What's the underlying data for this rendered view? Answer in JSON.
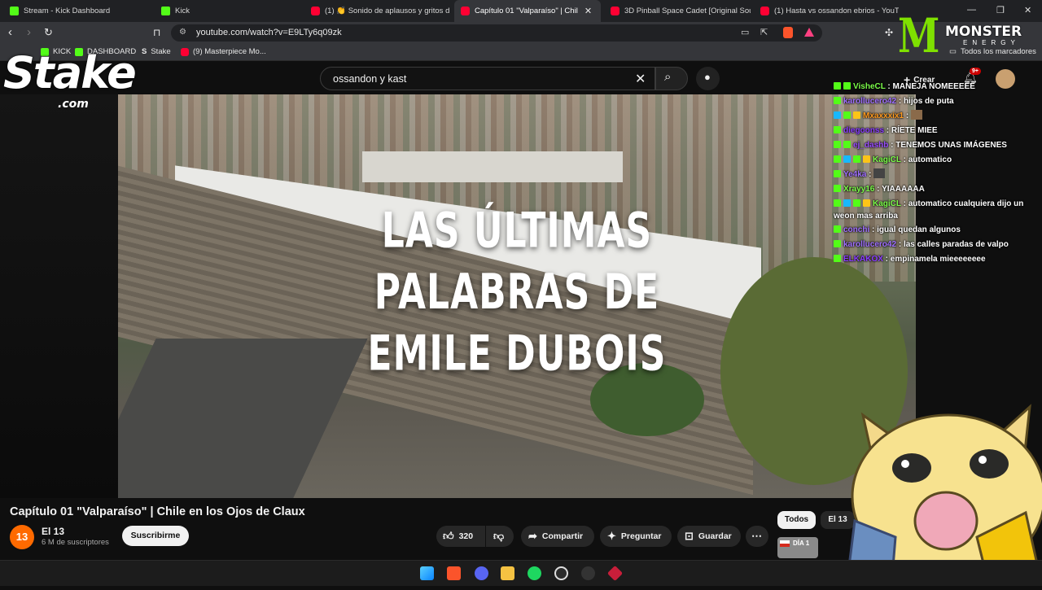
{
  "browser": {
    "tabs": [
      {
        "label": "Stream - Kick Dashboard",
        "icon": "kick-icon"
      },
      {
        "label": "Kick",
        "icon": "kick-icon"
      },
      {
        "label": "(1) 👏 Sonido de aplausos y gritos d",
        "icon": "youtube-icon"
      },
      {
        "label": "Capítulo 01 \"Valparaíso\" | Chil",
        "icon": "youtube-icon",
        "active": true
      },
      {
        "label": "3D Pinball Space Cadet [Original Sou",
        "icon": "youtube-icon"
      },
      {
        "label": "(1) Hasta vs ossandon ebrios - YouTu",
        "icon": "youtube-icon"
      }
    ],
    "url": "youtube.com/watch?v=E9LTy6q09zk",
    "bookmarks": [
      {
        "label": "KICK",
        "icon": "kick-icon"
      },
      {
        "label": "DASHBOARD",
        "icon": "kick-icon"
      },
      {
        "label": "Stake",
        "icon": "stake-icon"
      },
      {
        "label": "(9) Masterpiece Mo...",
        "icon": "youtube-icon"
      }
    ],
    "all_bookmarks": "Todos los marcadores"
  },
  "youtube": {
    "search_query": "ossandon y kast",
    "create_label": "Crear",
    "notifications_badge": "9+",
    "video_overlay_text": [
      "LAS ÚLTIMAS",
      "PALABRAS DE",
      "EMILE DUBOIS"
    ],
    "video_title": "Capítulo 01 \"Valparaíso\" | Chile en los Ojos de Claux",
    "channel": {
      "name": "El 13",
      "avatar_text": "13",
      "subscribers": "6 M de suscriptores"
    },
    "subscribe_label": "Suscribirme",
    "likes": "320",
    "actions": {
      "share": "Compartir",
      "ask": "Preguntar",
      "save": "Guardar"
    },
    "chips": {
      "all": "Todos",
      "channel": "El 13"
    },
    "thumbnail_label": "DÍA 1"
  },
  "chat": [
    {
      "user": "VisheCL",
      "text": "MANEJA NOMEEEEE",
      "color": "#7CFC4A"
    },
    {
      "user": "karollucero42",
      "text": "hijos de puta",
      "color": "#A070FF"
    },
    {
      "user": "Mxaxxxix1",
      "text": "",
      "color": "#FF9A1F"
    },
    {
      "user": "diegoonss",
      "text": "RÍETE MIEE",
      "color": "#8A3DFF"
    },
    {
      "user": "ej_dashb",
      "text": "TENEMOS UNAS IMÁGENES",
      "color": "#9A4DFF"
    },
    {
      "user": "KagiCL",
      "text": "automatico",
      "color": "#7CFC4A"
    },
    {
      "user": "Ye4ka",
      "text": "",
      "color": "#A070FF"
    },
    {
      "user": "Xrayy16",
      "text": "YIAAAAAA",
      "color": "#7CFC4A"
    },
    {
      "user": "KagiCL",
      "text": "automatico cualquiera dijo un weon mas arriba",
      "color": "#7CFC4A"
    },
    {
      "user": "conchi",
      "text": "igual quedan algunos",
      "color": "#A070FF"
    },
    {
      "user": "karollucero42",
      "text": "las calles paradas de valpo",
      "color": "#A070FF"
    },
    {
      "user": "ELKAKOX",
      "text": "empinamela mieeeeeeee",
      "color": "#8A3DFF"
    }
  ],
  "overlays": {
    "stake_word": "Stake",
    "stake_domain": ".com",
    "monster_word": "MONSTER",
    "monster_sub": "ENERGY"
  }
}
